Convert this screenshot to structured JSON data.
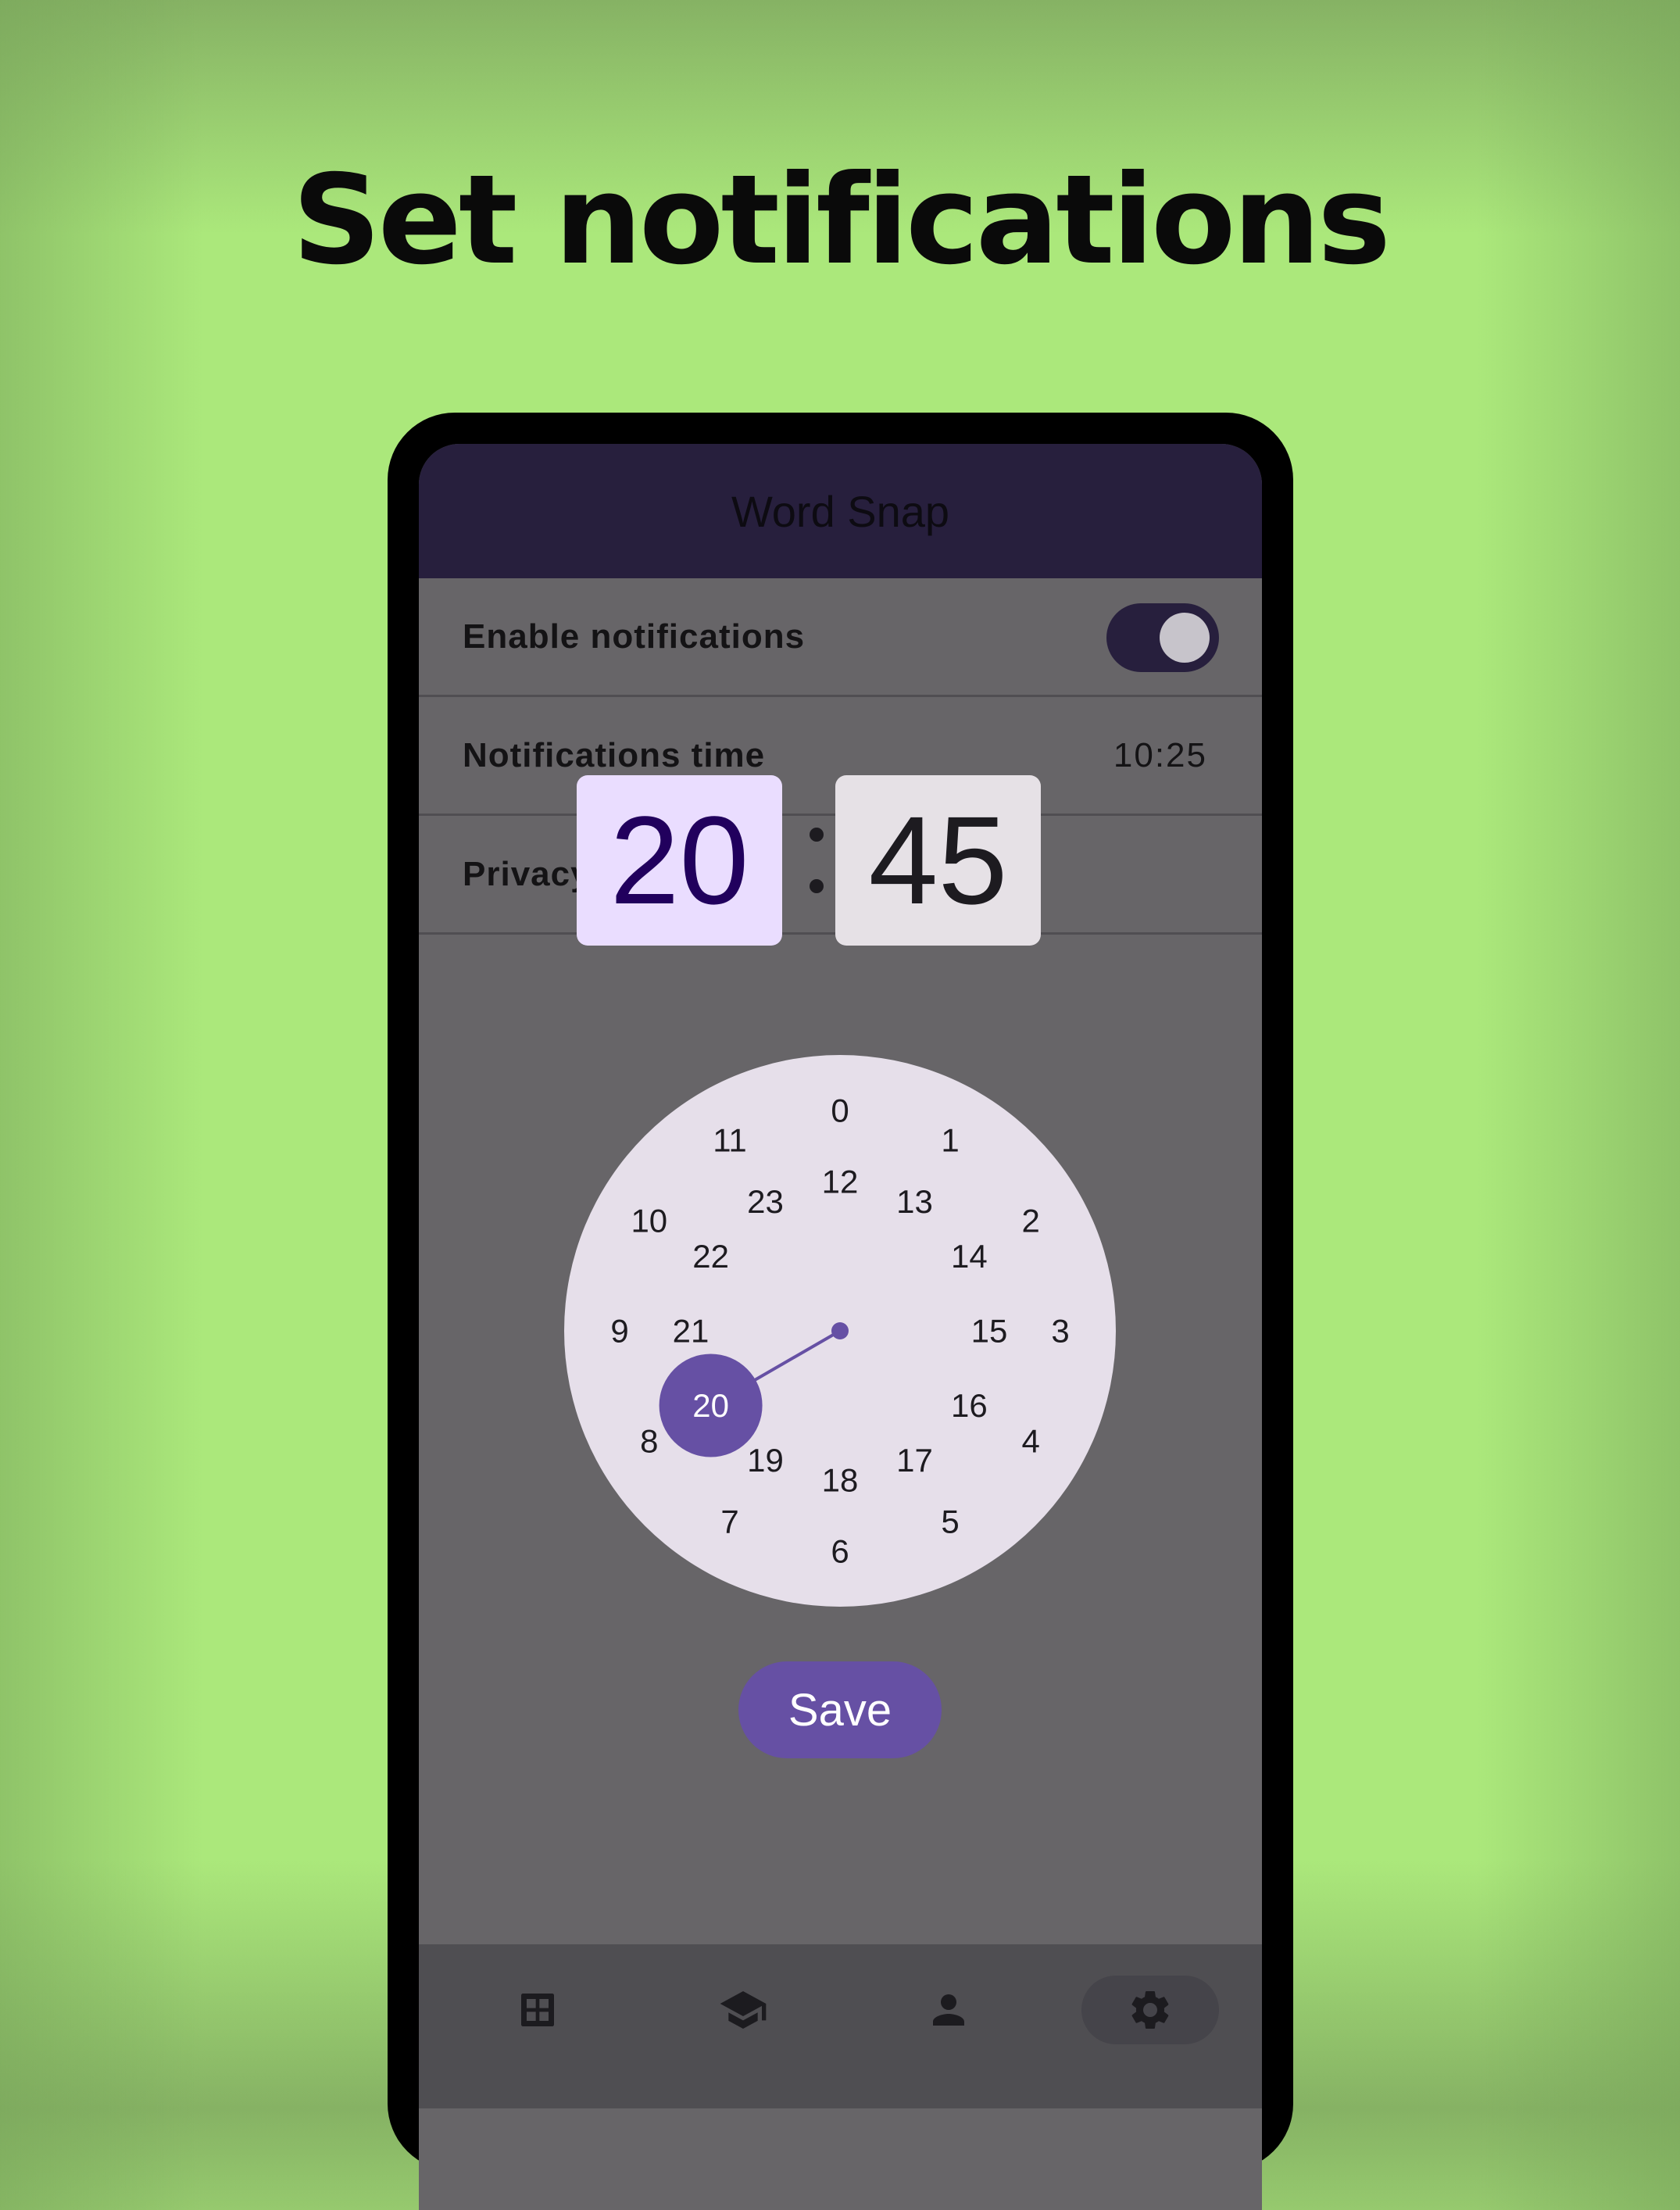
{
  "headline": "Set notifications",
  "app": {
    "title": "Word Snap"
  },
  "settings": {
    "enable_notifications_label": "Enable notifications",
    "enable_notifications_on": true,
    "notifications_time_label": "Notifications time",
    "notifications_time_value": "10:25",
    "privacy_policy_label": "Privacy P"
  },
  "time_picker": {
    "hour": "20",
    "minute": "45",
    "selected_hour": 20,
    "outer_ring": [
      "0",
      "1",
      "2",
      "3",
      "4",
      "5",
      "6",
      "7",
      "8",
      "9",
      "10",
      "11"
    ],
    "inner_ring": [
      "12",
      "13",
      "14",
      "15",
      "16",
      "17",
      "18",
      "19",
      "20",
      "21",
      "22",
      "23"
    ],
    "save_label": "Save"
  },
  "nav": {
    "items": [
      {
        "name": "dashboard",
        "icon": "grid-icon",
        "active": false
      },
      {
        "name": "learn",
        "icon": "graduation-cap-icon",
        "active": false
      },
      {
        "name": "profile",
        "icon": "person-icon",
        "active": false
      },
      {
        "name": "settings",
        "icon": "gear-icon",
        "active": true
      }
    ]
  },
  "colors": {
    "background": "#abe87b",
    "app_bar": "#271f3d",
    "accent": "#6650a4",
    "dial_face": "#e6dfea",
    "hour_box": "#eaddff",
    "minute_box": "#e6e1e6"
  }
}
